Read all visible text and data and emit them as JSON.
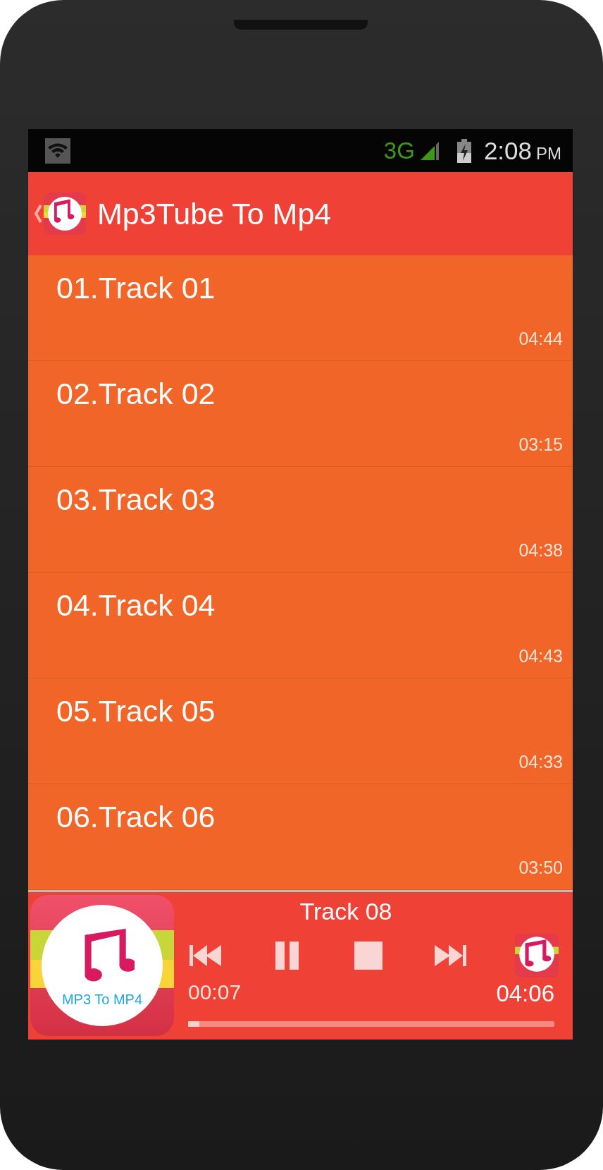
{
  "status_bar": {
    "network": "3G",
    "time": "2:08",
    "ampm": "PM"
  },
  "app_bar": {
    "title": "Mp3Tube To Mp4"
  },
  "tracks": [
    {
      "title": "01.Track 01",
      "duration": "04:44"
    },
    {
      "title": "02.Track 02",
      "duration": "03:15"
    },
    {
      "title": "03.Track 03",
      "duration": "04:38"
    },
    {
      "title": "04.Track 04",
      "duration": "04:43"
    },
    {
      "title": "05.Track 05",
      "duration": "04:33"
    },
    {
      "title": "06.Track 06",
      "duration": "03:50"
    }
  ],
  "player": {
    "logo_text": "MP3 To MP4",
    "now_playing": "Track 08",
    "elapsed": "00:07",
    "total": "04:06",
    "level": 0.03
  }
}
